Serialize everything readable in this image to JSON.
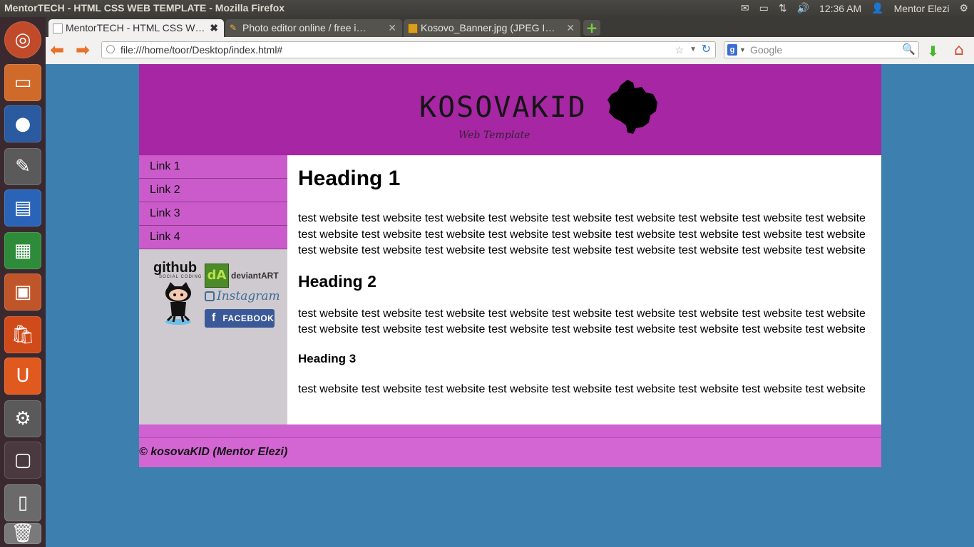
{
  "window_title": "MentorTECH - HTML CSS WEB TEMPLATE - Mozilla Firefox",
  "panel": {
    "time": "12:36 AM",
    "user": "Mentor Elezi"
  },
  "tabs": [
    {
      "label": "MentorTECH - HTML CSS W…",
      "active": true
    },
    {
      "label": "Photo editor online / free i…",
      "active": false
    },
    {
      "label": "Kosovo_Banner.jpg (JPEG I…",
      "active": false
    }
  ],
  "urlbar": {
    "value": "file:///home/toor/Desktop/index.html#"
  },
  "search": {
    "placeholder": "Google"
  },
  "site": {
    "brand": "KOSOVAKID",
    "tagline": "Web Template",
    "nav": [
      "Link 1",
      "Link 2",
      "Link 3",
      "Link 4"
    ],
    "social": {
      "github": "github",
      "github_sub": "SOCIAL CODING",
      "deviantart": "deviantART",
      "instagram": "Instagram",
      "facebook": "FACEBOOK"
    },
    "heading1": "Heading 1",
    "para1": "test website test website test website test website test website test website test website test website test website test website test website test website test website test website test website test website test website test website test website test website test website test website test website test website test website test website test website",
    "heading2": "Heading 2",
    "para2": "test website test website test website test website test website test website test website test website test website test website test website test website test website test website test website test website test website test website",
    "heading3": "Heading 3",
    "para3": "test website test website test website test website test website test website test website test website test website",
    "footer": "© kosovaKID (Mentor Elezi)"
  }
}
